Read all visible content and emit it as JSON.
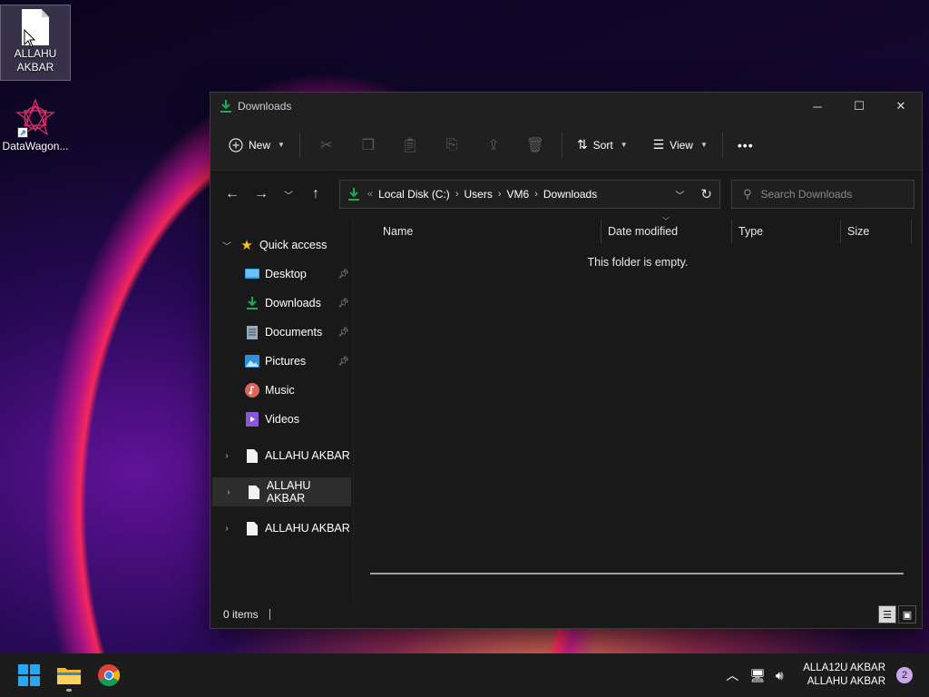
{
  "desktop": {
    "icons": [
      {
        "label": "ALLAHU AKBAR",
        "icon": "file-icon",
        "selected": true
      },
      {
        "label": "DataWagon...",
        "icon": "datawagon-app-icon",
        "shortcut": true
      }
    ]
  },
  "window": {
    "title": "Downloads",
    "controls": {
      "minimize": "─",
      "maximize": "☐",
      "close": "✕"
    },
    "commandbar": {
      "new_label": "New",
      "sort_label": "Sort",
      "view_label": "View",
      "more_label": "•••",
      "disabled_icons": [
        "cut-icon",
        "copy-icon",
        "paste-icon",
        "rename-icon",
        "share-icon",
        "delete-icon"
      ]
    },
    "address": {
      "overflow": "«",
      "crumbs": [
        "Local Disk (C:)",
        "Users",
        "VM6",
        "Downloads"
      ],
      "separator": "›"
    },
    "search": {
      "placeholder": "Search Downloads"
    },
    "sidebar": {
      "quick_access_label": "Quick access",
      "pinned": [
        {
          "label": "Desktop",
          "icon": "desktop-icon",
          "pinned": true
        },
        {
          "label": "Downloads",
          "icon": "download-icon",
          "pinned": true
        },
        {
          "label": "Documents",
          "icon": "documents-icon",
          "pinned": true
        },
        {
          "label": "Pictures",
          "icon": "pictures-icon",
          "pinned": true
        },
        {
          "label": "Music",
          "icon": "music-icon",
          "pinned": false
        },
        {
          "label": "Videos",
          "icon": "videos-icon",
          "pinned": false
        }
      ],
      "drives": [
        {
          "label": "ALLAHU AKBAR",
          "icon": "file-icon",
          "highlighted": false
        },
        {
          "label": "ALLAHU AKBAR",
          "icon": "file-icon",
          "highlighted": true
        },
        {
          "label": "ALLAHU AKBAR",
          "icon": "file-icon",
          "highlighted": false
        }
      ]
    },
    "columns": [
      "Name",
      "Date modified",
      "Type",
      "Size"
    ],
    "empty_message": "This folder is empty.",
    "status": {
      "items_text": "0 items"
    }
  },
  "taskbar": {
    "apps": [
      "start-icon",
      "file-explorer-icon",
      "chrome-icon"
    ],
    "clock_line1": "ALLA12U AKBAR",
    "clock_line2": "ALLAHU AKBAR",
    "notification_count": "2"
  },
  "colors": {
    "accent": "#0f9d58",
    "window_bg": "#191919",
    "toolbar_bg": "#202020",
    "taskbar_bg": "#1c1c1c"
  }
}
